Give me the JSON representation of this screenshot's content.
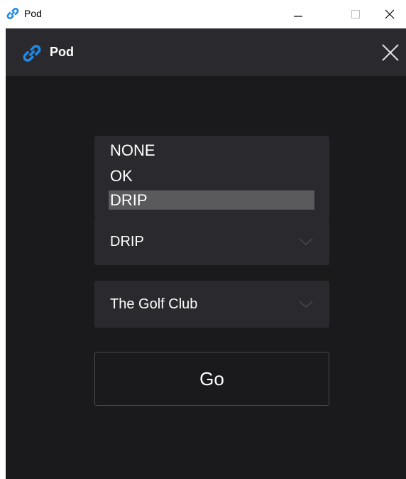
{
  "os_window": {
    "title": "Pod",
    "icon": "chain-link-icon"
  },
  "app": {
    "header": {
      "title": "Pod",
      "logo": "chain-link-icon",
      "close_icon": "close-icon"
    },
    "dropdown_list": {
      "items": [
        "NONE",
        "OK",
        "DRIP"
      ],
      "selected": "DRIP"
    },
    "select_status": {
      "value": "DRIP",
      "arrow_icon": "chevron-down-icon"
    },
    "select_club": {
      "value": "The Golf Club",
      "arrow_icon": "chevron-down-icon"
    },
    "go_button": {
      "label": "Go"
    }
  },
  "colors": {
    "app_background": "#1a191c",
    "header_background": "#2a292d",
    "control_background": "#2a292d",
    "selected_item": "#5a595c",
    "button_border": "#4a494d",
    "text": "#ffffff",
    "logo_blue": "#1e88e5"
  }
}
